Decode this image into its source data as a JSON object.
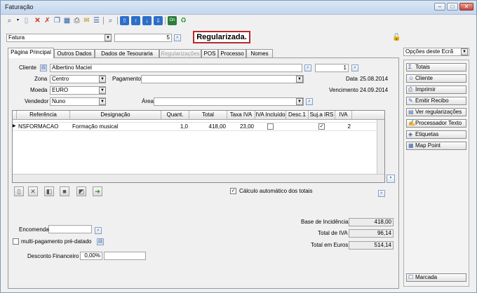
{
  "window": {
    "title": "Faturação"
  },
  "colors": {
    "accent": "#2c5aa0",
    "status_border": "#b7282e",
    "window_bg": "#f0f0f0"
  },
  "toolbar": {
    "icons": [
      "search-icon",
      "new-icon",
      "delete-icon",
      "cancel-icon",
      "copy-icon",
      "table-icon",
      "print-icon",
      "email-icon",
      "list-icon",
      "preview-icon",
      "first-icon",
      "up-icon",
      "down-icon",
      "last-icon",
      "calculator-icon",
      "refresh-icon"
    ]
  },
  "doc": {
    "type": "Fatura",
    "number": "5",
    "status": "Regularizada."
  },
  "tabs": [
    "Página Principal",
    "Outros Dados",
    "Dados de Tesouraria",
    "Regularizações",
    "POS",
    "Processo",
    "Nomes"
  ],
  "form": {
    "cliente_label": "Cliente",
    "cliente": "Albertino Maciel",
    "cliente_num": "1",
    "zona_label": "Zona",
    "zona": "Centro",
    "pagamento_label": "Pagamento",
    "pagamento": "",
    "data_label": "Data",
    "data": "25.08.2014",
    "moeda_label": "Moeda",
    "moeda": "EURO",
    "vencimento_label": "Vencimento",
    "vencimento": "24.09.2014",
    "vendedor_label": "Vendedor",
    "vendedor": "Nuno",
    "area_label": "Área",
    "area": ""
  },
  "grid": {
    "headers": [
      "Referência",
      "Designação",
      "Quant.",
      "Total",
      "Taxa IVA",
      "IVA Incluído",
      "Desc.1",
      "Suj.a IRS",
      "IVA"
    ],
    "rows": [
      {
        "ref": "NSFORMACAO",
        "designacao": "Formação musical",
        "quant": "1,0",
        "total": "418,00",
        "taxa": "23,00",
        "iva_incluido": false,
        "desc": "",
        "suj_irs": true,
        "iva": "2"
      }
    ]
  },
  "calc_auto_label": "Cálculo automático dos totais",
  "totals": {
    "base_label": "Base de Incidência",
    "base": "418,00",
    "iva_label": "Total de IVA",
    "iva": "96,14",
    "euros_label": "Total em Euros",
    "euros": "514,14"
  },
  "bottom": {
    "encomenda_label": "Encomenda",
    "encomenda": "",
    "multi_label": "multi-pagamento pré-datado",
    "desconto_label": "Desconto Financeiro",
    "desconto": "0,00%"
  },
  "side": {
    "options_label": "Opções deste Ecrã",
    "buttons": [
      "Totais",
      "Cliente",
      "Imprimir",
      "Emitir Recibo",
      "Ver regularizações",
      "Processador Texto",
      "Etiquetas",
      "Map Point"
    ],
    "marcada": "Marcada"
  }
}
